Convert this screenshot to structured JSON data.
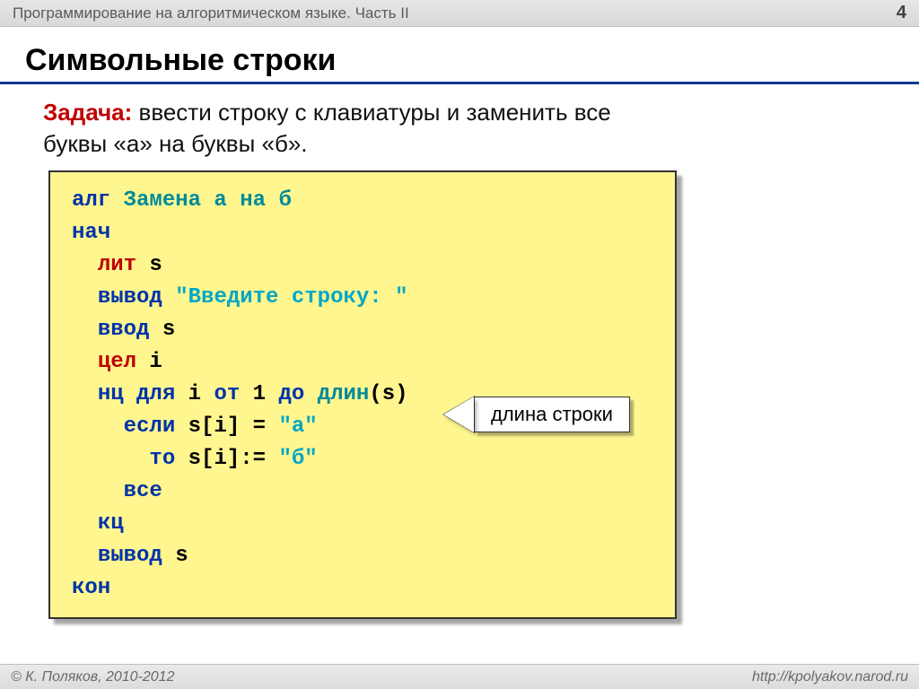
{
  "header": {
    "title": "Программирование на алгоритмическом языке. Часть II",
    "page": "4"
  },
  "title": "Символьные строки",
  "task": {
    "label": "Задача:",
    "text_1": " ввести строку с клавиатуры и заменить все",
    "text_2": "буквы «а» на буквы «б»."
  },
  "code": {
    "l1_alg": "алг ",
    "l1_name": "Замена а на б",
    "l2": "нач",
    "l3_kw": "лит",
    "l3_v": " s",
    "l4_kw": "вывод ",
    "l4_str": "\"Введите строку: \"",
    "l5": "ввод",
    "l5_v": " s",
    "l6_kw": "цел",
    "l6_v": " i",
    "l7_a": "нц для",
    "l7_b": " i ",
    "l7_c": "от",
    "l7_d": " 1 ",
    "l7_e": "до",
    "l7_f": " ",
    "l7_fn": "длин",
    "l7_g": "(s)",
    "l8_a": "если",
    "l8_b": " s[i] = ",
    "l8_c": "\"а\"",
    "l9_a": "то",
    "l9_b": " s[i]:= ",
    "l9_c": "\"б\"",
    "l10": "все",
    "l11": "кц",
    "l12_a": "вывод",
    "l12_b": " s",
    "l13": "кон"
  },
  "callout": "длина строки",
  "footer": {
    "copyright": "© К. Поляков, 2010-2012",
    "url": "http://kpolyakov.narod.ru"
  }
}
